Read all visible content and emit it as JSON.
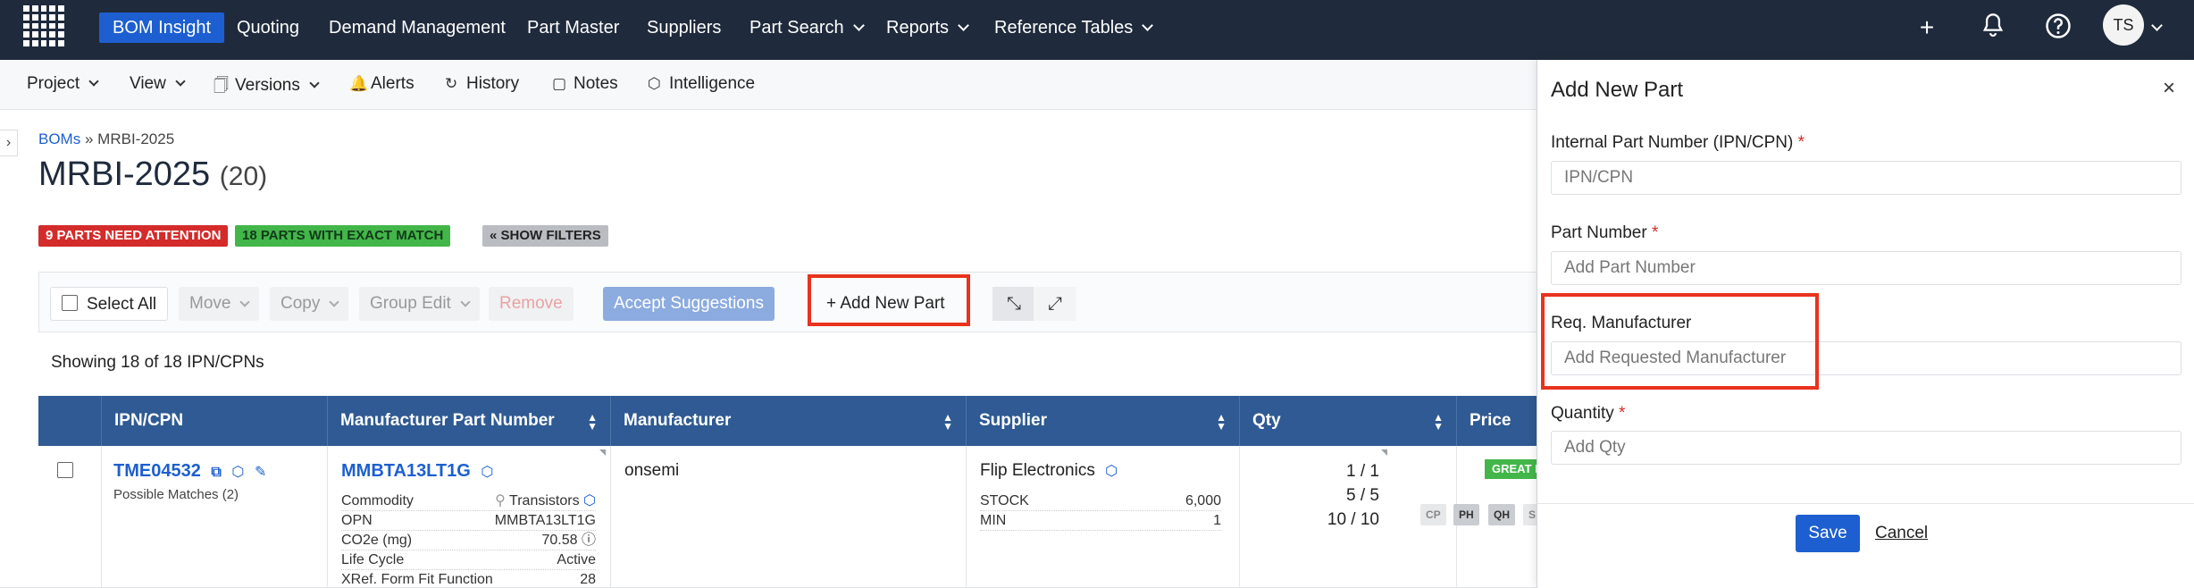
{
  "topnav": {
    "items": [
      "BOM Insight",
      "Quoting",
      "Demand Management",
      "Part Master",
      "Suppliers",
      "Part Search",
      "Reports",
      "Reference Tables"
    ],
    "avatar_initials": "TS",
    "colors": {
      "background": "#1f2a3c",
      "active": "#1d5fd0"
    },
    "icons": [
      "grid-logo-icon",
      "plus-icon",
      "bell-icon",
      "help-icon",
      "chevron-down-icon"
    ]
  },
  "subnav": {
    "project": "Project",
    "view": "View",
    "versions": "Versions",
    "alerts": "Alerts",
    "history": "History",
    "notes": "Notes",
    "intelligence": "Intelligence"
  },
  "breadcrumb": {
    "root": "BOMs",
    "separator": "»",
    "current": "MRBI-2025"
  },
  "page": {
    "title": "MRBI-2025",
    "count": "(20)"
  },
  "badges": {
    "attention": "9 PARTS NEED ATTENTION",
    "exact": "18 PARTS WITH EXACT MATCH",
    "filters": "« SHOW FILTERS"
  },
  "toolbar": {
    "select_all": "Select All",
    "move": "Move",
    "copy": "Copy",
    "group_edit": "Group Edit",
    "remove": "Remove",
    "accept": "Accept Suggestions",
    "add_new_part": "+ Add New Part"
  },
  "showing": "Showing 18 of 18 IPN/CPNs",
  "table": {
    "headers": [
      "IPN/CPN",
      "Manufacturer Part Number",
      "Manufacturer",
      "Supplier",
      "Qty",
      "Price"
    ],
    "rows": [
      {
        "ipn": "TME04532",
        "possible_matches": "Possible Matches (2)",
        "mpn": "MMBTA13LT1G",
        "details": [
          {
            "k": "Commodity",
            "v": "Transistors"
          },
          {
            "k": "OPN",
            "v": "MMBTA13LT1G"
          },
          {
            "k": "CO2e (mg)",
            "v": "70.58"
          },
          {
            "k": "Life Cycle",
            "v": "Active"
          },
          {
            "k": "XRef. Form Fit Function",
            "v": "28"
          }
        ],
        "manufacturer": "onsemi",
        "supplier": "Flip Electronics",
        "supplier_details": [
          {
            "k": "STOCK",
            "v": "6,000"
          },
          {
            "k": "MIN",
            "v": "1"
          }
        ],
        "qty": [
          "1 / 1",
          "5 / 5",
          "10 / 10"
        ],
        "price_badge": "GREAT P",
        "price_chips": [
          "CP",
          "PH",
          "QH",
          "S"
        ]
      }
    ]
  },
  "panel": {
    "title": "Add New Part",
    "fields": {
      "ipn": {
        "label": "Internal Part Number (IPN/CPN)",
        "placeholder": "IPN/CPN"
      },
      "part_number": {
        "label": "Part Number",
        "placeholder": "Add Part Number"
      },
      "req_manufacturer": {
        "label": "Req. Manufacturer",
        "placeholder": "Add Requested Manufacturer"
      },
      "quantity": {
        "label": "Quantity",
        "placeholder": "Add Qty"
      }
    },
    "required_mark": "*",
    "save": "Save",
    "cancel": "Cancel"
  }
}
